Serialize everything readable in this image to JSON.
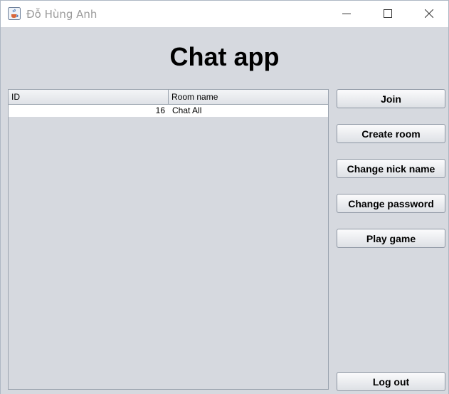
{
  "window": {
    "title": "Đỗ Hùng Anh",
    "icon": "java-cup-icon"
  },
  "main": {
    "heading": "Chat app"
  },
  "table": {
    "columns": [
      "ID",
      "Room name"
    ],
    "rows": [
      {
        "id": "16",
        "room_name": "Chat All"
      }
    ]
  },
  "buttons": {
    "join": "Join",
    "create_room": "Create room",
    "change_nick_name": "Change nick name",
    "change_password": "Change password",
    "play_game": "Play game",
    "log_out": "Log out"
  },
  "colors": {
    "window_bg": "#d6d9df",
    "titlebar_bg": "#ffffff",
    "selected_row_bg": "#ffffff"
  }
}
